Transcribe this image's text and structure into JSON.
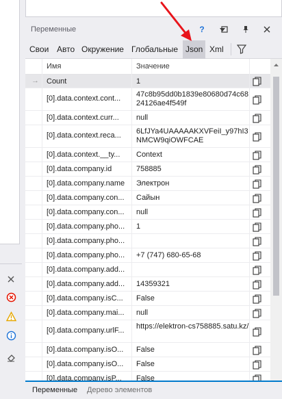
{
  "panel": {
    "title": "Переменные",
    "help_icon": "?",
    "tabs": [
      "Свои",
      "Авто",
      "Окружение",
      "Глобальные",
      "Json",
      "Xml"
    ],
    "active_tab": "Json"
  },
  "grid": {
    "headers": {
      "name": "Имя",
      "value": "Значение"
    },
    "rows": [
      {
        "name": "Count",
        "value": "1"
      },
      {
        "name": "[0].data.context.cont...",
        "value": "47c8b95dd0b1839e80680d74c6824126ae4f549f"
      },
      {
        "name": "[0].data.context.curr...",
        "value": "null"
      },
      {
        "name": "[0].data.context.reca...",
        "value": "6LfJYa4UAAAAAKXVFeiI_y97hI3NMCW9qiOWFCAE"
      },
      {
        "name": "[0].data.context.__ty...",
        "value": "Context"
      },
      {
        "name": "[0].data.company.id",
        "value": "758885"
      },
      {
        "name": "[0].data.company.name",
        "value": "Электрон"
      },
      {
        "name": "[0].data.company.con...",
        "value": "Сайын"
      },
      {
        "name": "[0].data.company.con...",
        "value": "null"
      },
      {
        "name": "[0].data.company.pho...",
        "value": "1"
      },
      {
        "name": "[0].data.company.pho...",
        "value": ""
      },
      {
        "name": "[0].data.company.pho...",
        "value": "+7 (747) 680-65-68"
      },
      {
        "name": "[0].data.company.add...",
        "value": ""
      },
      {
        "name": "[0].data.company.add...",
        "value": "14359321"
      },
      {
        "name": "[0].data.company.isC...",
        "value": "False"
      },
      {
        "name": "[0].data.company.mai...",
        "value": "null"
      },
      {
        "name": "[0].data.company.urlF...",
        "value": "https://elektron-cs758885.satu.kz/"
      },
      {
        "name": "[0].data.company.isO...",
        "value": "False"
      },
      {
        "name": "[0].data.company.isO...",
        "value": "False"
      },
      {
        "name": "[0].data.company.isP...",
        "value": "False"
      }
    ]
  },
  "bottom_tabs": [
    "Переменные",
    "Дерево элементов"
  ],
  "colors": {
    "accent": "#007acc",
    "selected_tab_bg": "#cfcfd6",
    "annotation_arrow": "#e8141b"
  },
  "icons": [
    "pin-icon",
    "close-icon",
    "maximize-icon",
    "filter-icon",
    "copy-icon",
    "error-icon",
    "warning-icon",
    "info-icon",
    "clear-icon"
  ]
}
